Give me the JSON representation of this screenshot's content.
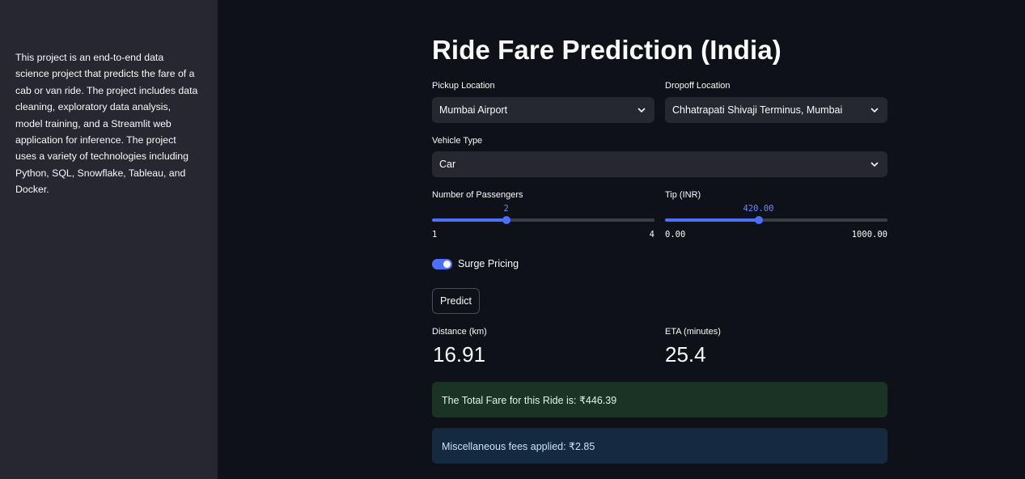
{
  "sidebar": {
    "description": "This project is an end-to-end data science project that predicts the fare of a cab or van ride. The project includes data cleaning, exploratory data analysis, model training, and a Streamlit web application for inference. The project uses a variety of technologies including Python, SQL, Snowflake, Tableau, and Docker."
  },
  "main": {
    "title": "Ride Fare Prediction (India)",
    "pickup": {
      "label": "Pickup Location",
      "value": "Mumbai Airport",
      "icon": "chevron-down-icon"
    },
    "dropoff": {
      "label": "Dropoff Location",
      "value": "Chhatrapati Shivaji Terminus, Mumbai",
      "icon": "chevron-down-icon"
    },
    "vehicle": {
      "label": "Vehicle Type",
      "value": "Car",
      "icon": "chevron-down-icon"
    },
    "passengers": {
      "label": "Number of Passengers",
      "value": "2",
      "min": "1",
      "max": "4",
      "fraction": 0.3333
    },
    "tip": {
      "label": "Tip (INR)",
      "value": "420.00",
      "min": "0.00",
      "max": "1000.00",
      "fraction": 0.42
    },
    "surge": {
      "label": "Surge Pricing",
      "enabled": true
    },
    "predict_label": "Predict",
    "distance": {
      "label": "Distance (km)",
      "value": "16.91"
    },
    "eta": {
      "label": "ETA (minutes)",
      "value": "25.4"
    },
    "total_fare": "The Total Fare for this Ride is: ₹446.39",
    "misc_fees": "Miscellaneous fees applied: ₹2.85"
  },
  "colors": {
    "background": "#0e1117",
    "sidebar": "#262730",
    "accent": "#4d6fff",
    "success_bg": "#1a3324",
    "info_bg": "#162a3f"
  }
}
